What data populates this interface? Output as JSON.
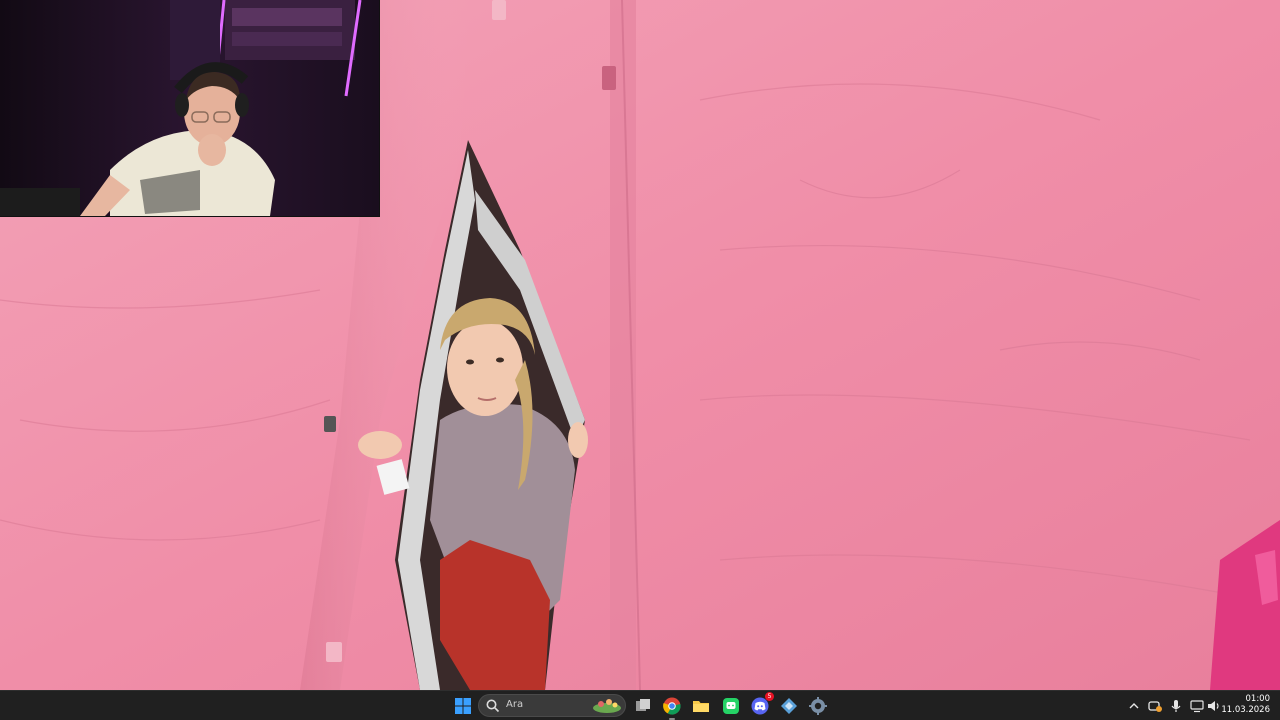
{
  "taskbar": {
    "search_placeholder": "Ara",
    "clock_time": "01:00",
    "clock_date": "11.03.2026",
    "discord_badge": "5"
  },
  "icons": {
    "start": "windows-start-icon",
    "search": "search-icon",
    "task_view": "task-view-icon",
    "chrome": "chrome-icon",
    "explorer": "file-explorer-icon",
    "whatsapp": "chat-app-icon",
    "discord": "discord-icon",
    "store": "app-icon",
    "settings": "settings-icon",
    "tray_overflow": "chevron-up-icon",
    "tray_app": "tray-app-icon",
    "mic": "microphone-icon",
    "network": "network-icon",
    "volume": "volume-icon"
  },
  "colors": {
    "taskbar_bg": "#202020",
    "tent_pink": "#f08aa6",
    "accent_blue": "#3aa0ff"
  }
}
